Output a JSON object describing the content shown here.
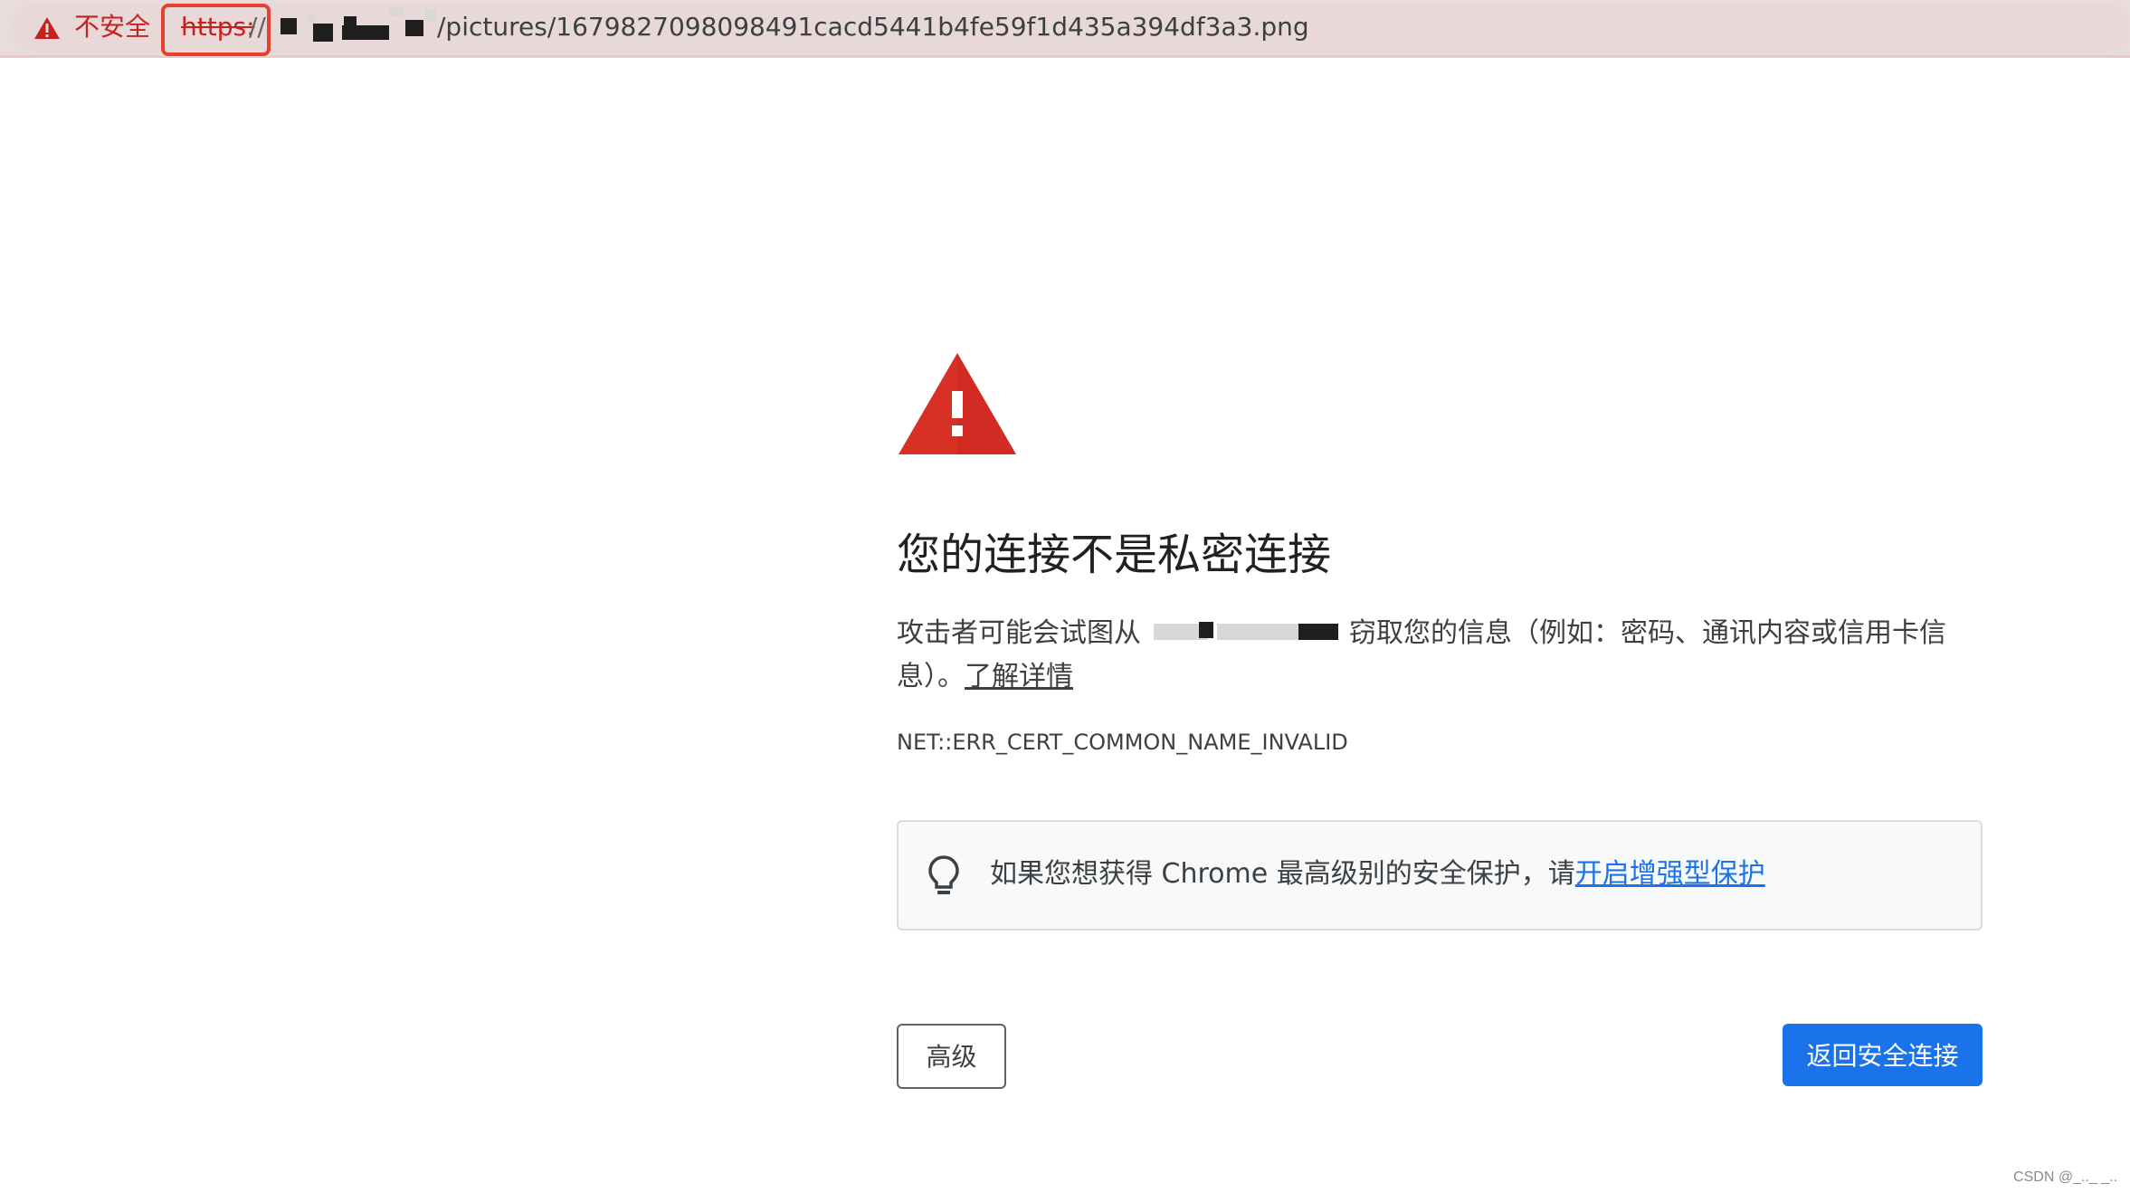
{
  "address_bar": {
    "security_label": "不安全",
    "scheme": "https:",
    "scheme_separator": "//",
    "url_path": "/pictures/1679827098098491cacd5441b4fe59f1d435a394df3a3.png",
    "warning_icon": "warning-triangle-icon"
  },
  "interstitial": {
    "icon": "warning-triangle-icon",
    "headline": "您的连接不是私密连接",
    "body_line1_prefix": "攻击者可能会试图从",
    "body_line1_suffix": "窃取您的信息（例如：密码、通讯内容或信用卡信",
    "body_line2_prefix": "息）。",
    "learn_more_link": "了解详情",
    "error_code": "NET::ERR_CERT_COMMON_NAME_INVALID",
    "protection": {
      "icon": "lightbulb-icon",
      "text": "如果您想获得 Chrome 最高级别的安全保护，请",
      "link": "开启增强型保护"
    },
    "advanced_button": "高级",
    "back_button": "返回安全连接"
  },
  "watermark": "CSDN @_.._ _.."
}
